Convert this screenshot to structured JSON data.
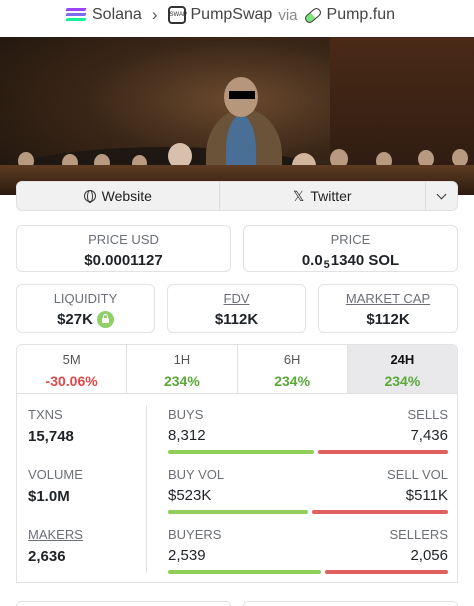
{
  "breadcrumb": {
    "chain": "Solana",
    "dex": "PumpSwap",
    "dex_icon_text": "SWAP",
    "via": "via",
    "launchpad": "Pump.fun"
  },
  "links": {
    "website": "Website",
    "twitter": "Twitter"
  },
  "price_usd": {
    "label": "PRICE USD",
    "value": "$0.0001127"
  },
  "price_sol": {
    "label": "PRICE",
    "prefix": "0.0",
    "zeros": "5",
    "digits": "1340 SOL"
  },
  "liquidity": {
    "label": "LIQUIDITY",
    "value": "$27K"
  },
  "fdv": {
    "label": "FDV",
    "value": "$112K"
  },
  "market_cap": {
    "label": "MARKET CAP",
    "value": "$112K"
  },
  "timeframes": [
    {
      "label": "5M",
      "change": "-30.06%",
      "trend": "neg"
    },
    {
      "label": "1H",
      "change": "234%",
      "trend": "pos"
    },
    {
      "label": "6H",
      "change": "234%",
      "trend": "pos"
    },
    {
      "label": "24H",
      "change": "234%",
      "trend": "pos",
      "selected": true
    }
  ],
  "stats": {
    "txns": {
      "label": "TXNS",
      "value": "15,748"
    },
    "volume": {
      "label": "VOLUME",
      "value": "$1.0M"
    },
    "makers": {
      "label": "MAKERS",
      "value": "2,636"
    },
    "buys": {
      "label": "BUYS",
      "value": "8,312"
    },
    "sells": {
      "label": "SELLS",
      "value": "7,436"
    },
    "buy_vol": {
      "label": "BUY VOL",
      "value": "$523K"
    },
    "sell_vol": {
      "label": "SELL VOL",
      "value": "$511K"
    },
    "buyers": {
      "label": "BUYERS",
      "value": "2,539"
    },
    "sellers": {
      "label": "SELLERS",
      "value": "2,056"
    }
  },
  "ratios": {
    "buys_share": 0.528,
    "buy_vol_share": 0.506,
    "buyers_share": 0.552
  },
  "colors": {
    "positive": "#5aa83a",
    "negative": "#e04848",
    "buy_bar": "#8fcf5a",
    "sell_bar": "#e06060"
  }
}
